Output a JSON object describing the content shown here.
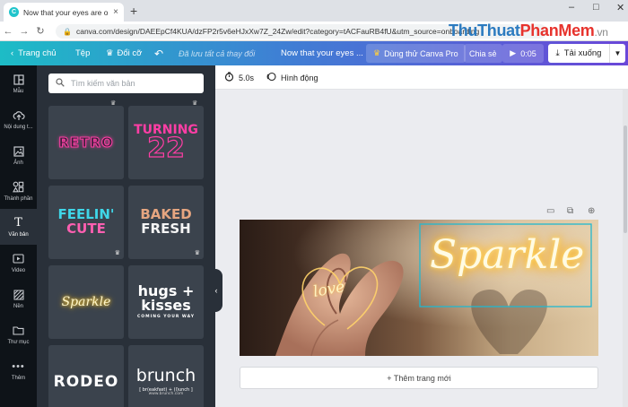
{
  "browser": {
    "tab_title": "Now that your eyes are open, m...",
    "new_tab": "+",
    "tab_close": "×",
    "url": "canva.com/design/DAEEpCf4KUA/dzFP2r5v6eHJxXw7Z_24Zw/edit?category=tACFauRB4fU&utm_source=onboarding",
    "win_min": "–",
    "win_max": "□",
    "win_close": "✕"
  },
  "watermark": {
    "a": "ThuThuat",
    "b": "PhanMem",
    "c": ".vn"
  },
  "topbar": {
    "home": "Trang chủ",
    "file": "Tệp",
    "resize": "Đổi cỡ",
    "saved": "Đã lưu tất cả thay đổi",
    "doc_title": "Now that your eyes ...",
    "try_pro": "Dùng thử Canva Pro",
    "share": "Chia sẻ",
    "play_time": "0:05",
    "download": "Tải xuống"
  },
  "rail": {
    "items": [
      {
        "label": "Mẫu"
      },
      {
        "label": "Nội dung t..."
      },
      {
        "label": "Ảnh"
      },
      {
        "label": "Thành phần"
      },
      {
        "label": "Văn bản"
      },
      {
        "label": "Video"
      },
      {
        "label": "Nền"
      },
      {
        "label": "Thư mục"
      },
      {
        "label": "Thêm"
      }
    ]
  },
  "panel": {
    "search_placeholder": "Tìm kiếm văn bản",
    "tiles": {
      "retro": "RETRO",
      "turning_a": "TURNING",
      "turning_b": "22",
      "feelin_a": "FEELIN'",
      "feelin_b": "CUTE",
      "baked_a": "BAKED",
      "baked_b": "FRESH",
      "sparkle": "Sparkle",
      "hugs_a": "hugs +",
      "hugs_b": "kisses",
      "hugs_c": "COMING YOUR WAY",
      "rodeo": "RODEO",
      "brunch_a": "brunch",
      "brunch_b": "[ br(eakfast) + (l)unch ]",
      "brunch_c": "www.brunch.com"
    }
  },
  "editor": {
    "duration": "5.0s",
    "animate": "Hình động",
    "canvas_text_love": "love",
    "canvas_text_sparkle": "Sparkle",
    "add_page": "+ Thêm trang mới"
  }
}
